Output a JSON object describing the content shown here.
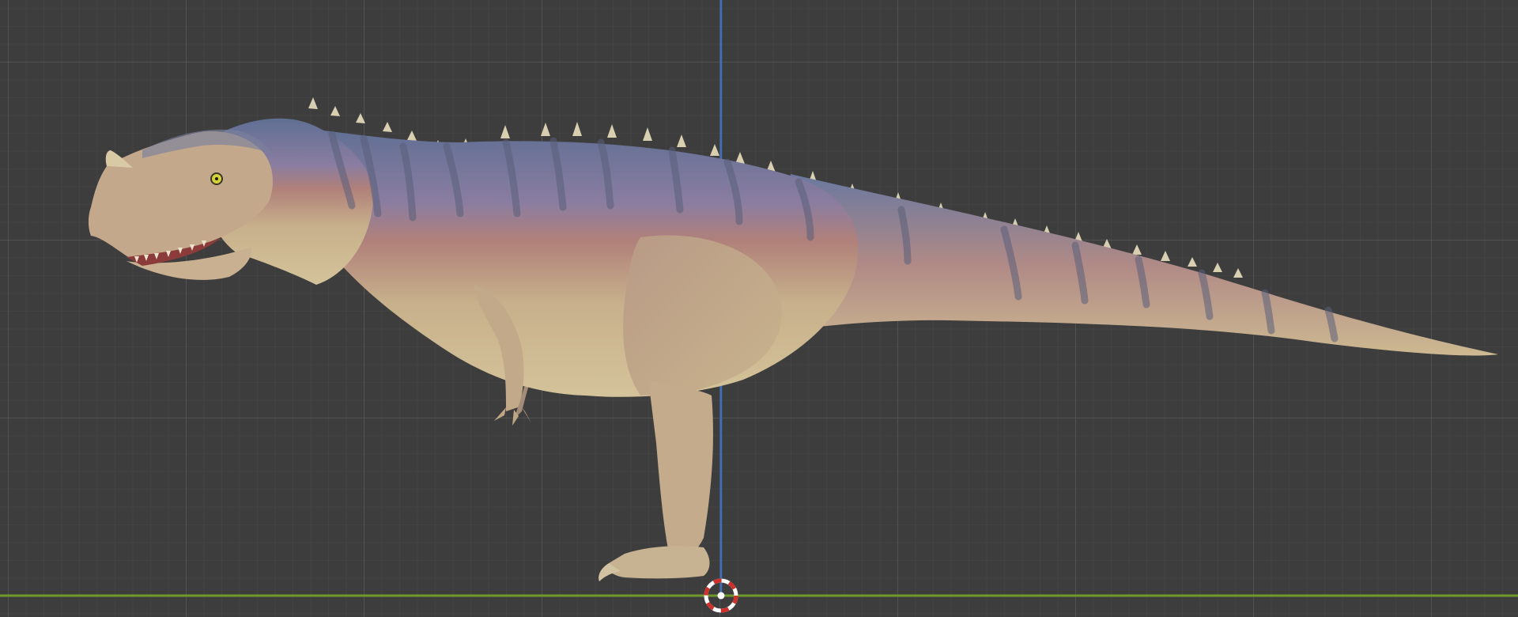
{
  "app": "3D viewport",
  "viewport": {
    "view": "front-orthographic",
    "grid": true,
    "background_color": "#3d3d3d",
    "grid_color": "#5c5c5c",
    "axis_colors": {
      "x_axis": "#6f9a2a",
      "z_axis": "#3a6fc2"
    }
  },
  "scene": {
    "model": "dinosaur-model",
    "cursor": "3d-cursor-icon",
    "origin_marker": "object-origin-dot"
  }
}
